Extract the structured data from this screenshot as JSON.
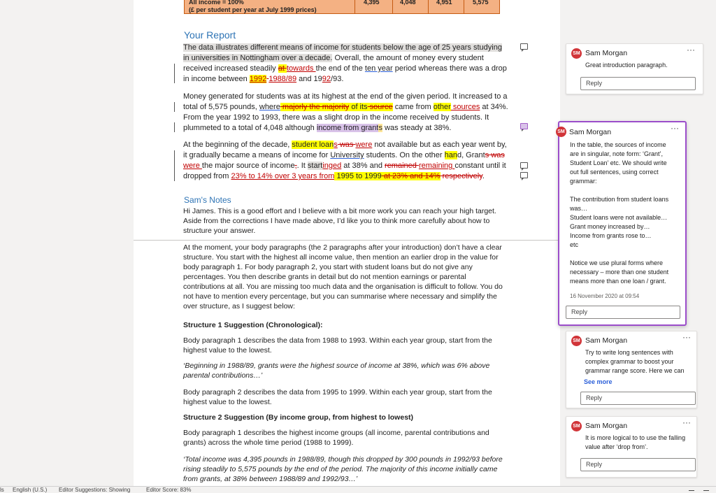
{
  "table_fragment": {
    "row_label_1": "All income = 100%",
    "row_label_2": "(£ per student per year at July 1999 prices)",
    "values": [
      "4,395",
      "4,048",
      "4,951",
      "5,575"
    ]
  },
  "report": {
    "heading": "Your Report",
    "p1": {
      "a": "The data illustrates different means of income for students below the age of 25 years studying in universities in Nottingham over a decade.",
      "b": " Overall, the amount of money every student received increased steadily ",
      "c_del": "at ",
      "c_ins": "towards ",
      "d": "the end of the ",
      "e_link": "ten year",
      "f": " period whereas there was a drop in income between ",
      "g_hl": "1992",
      "g_del": " ",
      "g_ins": "1988/89",
      "h": " and 19",
      "h_ins": "92",
      "i": "/93."
    },
    "p2": {
      "a": "Money generated for students was at its highest at the end of the given period. It increased to a total of 5,575 pounds, ",
      "b_link": "where",
      "c_del": " majorly the majority",
      "c_hl": " of its",
      "c_del2": " source",
      "d": " came from ",
      "e_hl": "other",
      "e_ins": " sources",
      "f": " at 34%. From the year 1992 to 1993, there was a slight drop in the income received by students. It plummeted to a total of 4,048 although ",
      "g_purp": "income from grant",
      "g_hl": "s",
      "h": " was steady at 38%."
    },
    "p3": {
      "a": "At the beginning of the decade, ",
      "b_hl": "student loan",
      "b_s": "s",
      "c_del": " was ",
      "c_ins": "were",
      "d": " not available but as each year went by, it gradually became a means of income for ",
      "e_link": "University",
      "f": " students. On the other ",
      "g_hl": "han",
      "g": "d, Grant",
      "g_del": "s was ",
      "g_ins": "were ",
      "h": "the major source of income",
      "h_del": ",",
      "i": ". It ",
      "j_grey": "start",
      "j_ins": "inged",
      "k": " at 38% and ",
      "l_del": "remained ",
      "l_ins": "remaining ",
      "m": "constant until it dropped from ",
      "n_ins": "23%",
      "n_ins2": " to 14% over 3 years from",
      "o_hl": " 1995 to 1999",
      "p_del": " at 23% and 14%",
      "q_del": " respectively",
      "r": "."
    }
  },
  "notes": {
    "heading": "Sam's Notes",
    "intro": "Hi James. This is a good effort and I believe with a bit more work you can reach your high target. Aside from the corrections I have made above, I’d like you to think more carefully about how to structure your answer.",
    "body1": "At the moment, your body paragraphs (the 2 paragraphs after your introduction) don’t have a clear structure. You start with the highest all income value, then mention an earlier drop in the value for body paragraph 1. For body paragraph 2, you start with student loans but do not give any percentages. You then describe grants in detail but do not mention earnings or parental contributions at all. You are missing too much data and the organisation is difficult to follow. You do not have to mention every percentage, but you can summarise where necessary and simplify the over structure, as I suggest below:",
    "s1_title": "Structure 1 Suggestion (Chronological):",
    "s1_p1": "Body paragraph 1 describes the data from 1988 to 1993. Within each year group, start from the highest value to the lowest.",
    "s1_quote": "‘Beginning in 1988/89, grants were the highest source of income at 38%, which was 6% above parental contributions…’",
    "s1_p2": "Body paragraph 2 describes the data from 1995 to 1999. Within each year group, start from the highest value to the lowest.",
    "s2_title": "Structure 2 Suggestion (By income group, from highest to lowest)",
    "s2_p1": "Body paragraph 1 describes the highest income groups (all income, parental contributions and grants) across the whole time period (1988 to 1999).",
    "s2_quote": "‘Total income was 4,395 pounds in 1988/89, though this dropped by 300 pounds in 1992/93 before rising steadily to 5,575 pounds by the end of the period. The majority of this income initially came from grants, at 38% between 1988/89 and 1992/93…’"
  },
  "comments": [
    {
      "initials": "SM",
      "author": "Sam Morgan",
      "text": "Great introduction paragraph.",
      "reply": "Reply"
    },
    {
      "initials": "SM",
      "author": "Sam Morgan",
      "lines": [
        "In the table, the sources of income",
        "are in singular, note form: ‘Grant’,",
        "Student Loan’ etc. We should write",
        "out full sentences, using correct",
        "grammar:",
        "",
        "The contribution from student loans",
        "was…",
        "Student loans were not available…",
        "Grant money increased by…",
        "Income from grants rose to…",
        "etc",
        "",
        "Notice we use plural forms where",
        "necessary – more than one student",
        "means more than one loan / grant."
      ],
      "date": "16 November 2020 at 09:54",
      "reply": "Reply"
    },
    {
      "initials": "SM",
      "author": "Sam Morgan",
      "lines": [
        "Try to write long sentences with",
        "complex grammar to boost your",
        "grammar range score. Here we can"
      ],
      "see_more": "See more",
      "reply": "Reply"
    },
    {
      "initials": "SM",
      "author": "Sam Morgan",
      "lines": [
        "It is more logical to to use the falling",
        "value after ‘drop from’."
      ],
      "reply": "Reply"
    }
  ],
  "statusbar": {
    "words": "ls",
    "language": "English (U.S.)",
    "editor_suggestions": "Editor Suggestions: Showing",
    "editor_score": "Editor Score: 83%"
  },
  "colors": {
    "accent_purple": "#9b4dca",
    "heading_blue": "#2e74b5",
    "highlight_yellow": "#ffff00",
    "revision_red": "#c00000",
    "table_orange": "#f4b183"
  }
}
